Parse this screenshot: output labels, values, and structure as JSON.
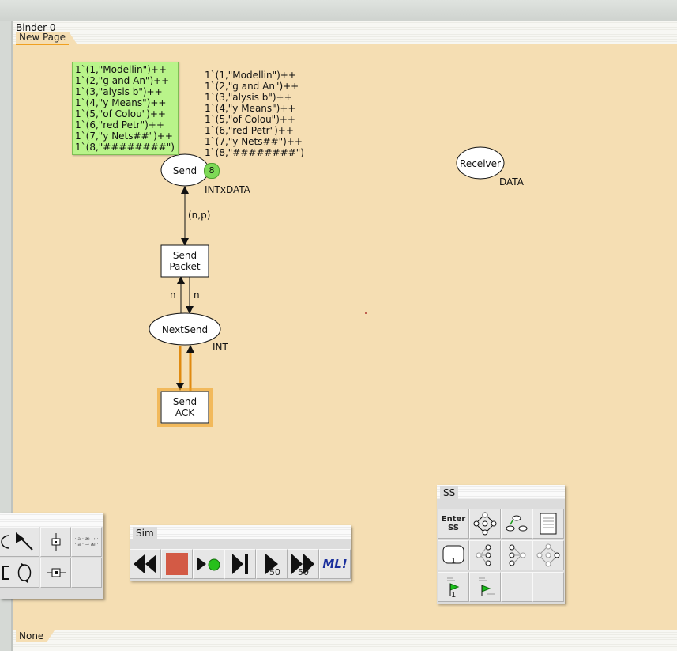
{
  "binder": {
    "title": "Binder 0",
    "page_tab": "New Page",
    "footer_tab": "None"
  },
  "net": {
    "places": [
      {
        "id": "send",
        "name": "Send",
        "colset": "INTxDATA",
        "token_count": "8"
      },
      {
        "id": "receiver",
        "name": "Receiver",
        "colset": "DATA"
      },
      {
        "id": "nextsend",
        "name": "NextSend",
        "colset": "INT"
      }
    ],
    "transitions": [
      {
        "id": "send_packet",
        "line1": "Send",
        "line2": "Packet"
      },
      {
        "id": "send_ack",
        "line1": "Send",
        "line2": "ACK"
      }
    ],
    "arcs": [
      {
        "id": "arc_np",
        "inscription": "(n,p)"
      },
      {
        "id": "arc_n_left",
        "inscription": "n"
      },
      {
        "id": "arc_n_right",
        "inscription": "n"
      }
    ],
    "current_marking": [
      "1`(1,\"Modellin\")++",
      "1`(2,\"g and An\")++",
      "1`(3,\"alysis b\")++",
      "1`(4,\"y Means\")++",
      "1`(5,\"of Colou\")++",
      "1`(6,\"red Petr\")++",
      "1`(7,\"y Nets##\")++",
      "1`(8,\"########\")"
    ],
    "initial_marking": [
      "1`(1,\"Modellin\")++",
      "1`(2,\"g and An\")++",
      "1`(3,\"alysis b\")++",
      "1`(4,\"y Means\")++",
      "1`(5,\"of Colou\")++",
      "1`(6,\"red Petr\")++",
      "1`(7,\"y Nets##\")++",
      "1`(8,\"########\")"
    ]
  },
  "palettes": {
    "sim": {
      "label": "Sim",
      "tools": [
        {
          "name": "rewind",
          "icon": "rewind-icon"
        },
        {
          "name": "stop",
          "icon": "stop-icon"
        },
        {
          "name": "play-single",
          "icon": "play-dot-icon"
        },
        {
          "name": "step",
          "icon": "step-icon"
        },
        {
          "name": "play-50",
          "icon": "play-icon",
          "count": "50"
        },
        {
          "name": "fast-forward-50",
          "icon": "fast-forward-icon",
          "count": "50"
        },
        {
          "name": "ml",
          "icon": "ml-icon",
          "text": "ML!"
        }
      ]
    },
    "ss": {
      "label": "SS",
      "enter_text_1": "Enter",
      "enter_text_2": "SS",
      "badge_1": "1",
      "badge_2": "1"
    },
    "create": {
      "tiny_text_1": "· a · æ → ·",
      "tiny_text_2": "· a · → æ ·"
    }
  },
  "colors": {
    "canvas": "#f5deb3",
    "marking": "#b9f48a",
    "token": "#7ed957",
    "enabled_highlight": "#f0a020",
    "stop_red": "#d35a45",
    "ml_blue": "#1a2f9c"
  }
}
